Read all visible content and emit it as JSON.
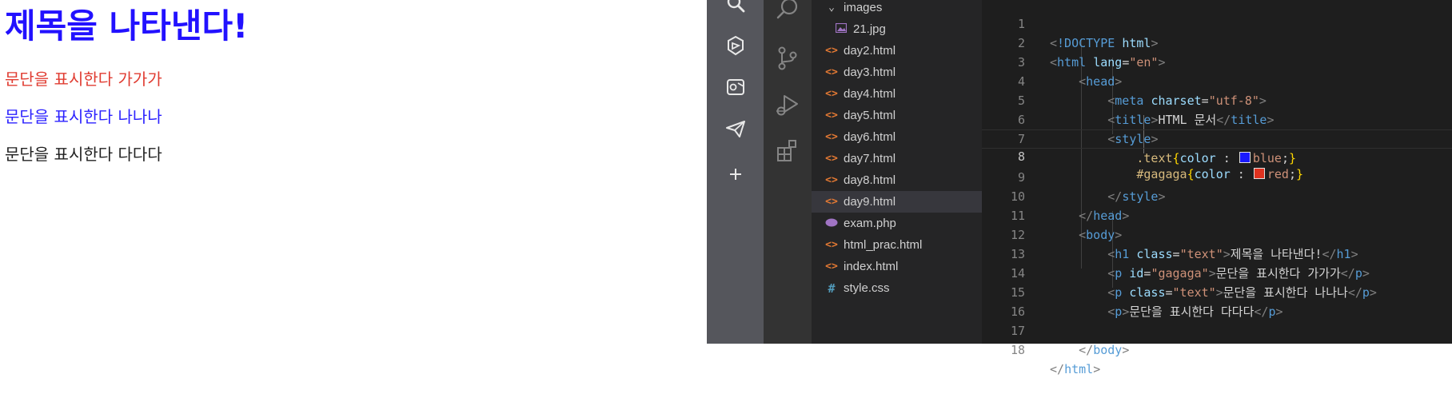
{
  "preview": {
    "heading": "제목을 나타낸다!",
    "paragraphs": [
      "문단을 표시한다 가가가",
      "문단을 표시한다 나나나",
      "문단을 표시한다 다다다"
    ]
  },
  "colors": {
    "heading": "#2211ff",
    "red_para": "#e03c31",
    "blue_para": "#2c22ff",
    "black_para": "#1f1f1f",
    "swatch_blue": "#1a1aff",
    "swatch_red": "#e0321f"
  },
  "explorer": {
    "items": [
      {
        "icon": "chevron-down-icon",
        "label": "images",
        "selected": false
      },
      {
        "icon": "image-file-icon",
        "label": "21.jpg",
        "selected": false
      },
      {
        "icon": "html-file-icon",
        "label": "day2.html",
        "selected": false
      },
      {
        "icon": "html-file-icon",
        "label": "day3.html",
        "selected": false
      },
      {
        "icon": "html-file-icon",
        "label": "day4.html",
        "selected": false
      },
      {
        "icon": "html-file-icon",
        "label": "day5.html",
        "selected": false
      },
      {
        "icon": "html-file-icon",
        "label": "day6.html",
        "selected": false
      },
      {
        "icon": "html-file-icon",
        "label": "day7.html",
        "selected": false
      },
      {
        "icon": "html-file-icon",
        "label": "day8.html",
        "selected": false
      },
      {
        "icon": "html-file-icon",
        "label": "day9.html",
        "selected": true
      },
      {
        "icon": "php-file-icon",
        "label": "exam.php",
        "selected": false
      },
      {
        "icon": "html-file-icon",
        "label": "html_prac.html",
        "selected": false
      },
      {
        "icon": "html-file-icon",
        "label": "index.html",
        "selected": false
      },
      {
        "icon": "css-file-icon",
        "label": "style.css",
        "selected": false
      }
    ]
  },
  "editor": {
    "active_line": 8,
    "lines": [
      {
        "n": "1"
      },
      {
        "n": "2"
      },
      {
        "n": "3"
      },
      {
        "n": "4"
      },
      {
        "n": "5"
      },
      {
        "n": "6"
      },
      {
        "n": "7"
      },
      {
        "n": "8"
      },
      {
        "n": "9"
      },
      {
        "n": "10"
      },
      {
        "n": "11"
      },
      {
        "n": "12"
      },
      {
        "n": "13"
      },
      {
        "n": "14"
      },
      {
        "n": "15"
      },
      {
        "n": "16"
      },
      {
        "n": "17"
      },
      {
        "n": "18"
      }
    ],
    "code": {
      "doctype": "!DOCTYPE",
      "html_kw": "html",
      "lang_attr": "lang",
      "lang_val": "\"en\"",
      "head": "head",
      "meta": "meta",
      "charset_attr": "charset",
      "charset_val": "\"utf-8\"",
      "title_tag": "title",
      "title_text": "HTML 문서",
      "style_tag": "style",
      "css_sel_1": ".text",
      "css_prop": "color",
      "css_val_1": "blue",
      "css_sel_2": "#gagaga",
      "css_val_2": "red",
      "body": "body",
      "h1": "h1",
      "class_attr": "class",
      "class_val": "\"text\"",
      "h1_text": "제목을 나타낸다!",
      "p": "p",
      "id_attr": "id",
      "id_val": "\"gagaga\"",
      "p1_text": "문단을 표시한다 가가가",
      "p2_text": "문단을 표시한다 나나나",
      "p3_text": "문단을 표시한다 다다다"
    }
  }
}
